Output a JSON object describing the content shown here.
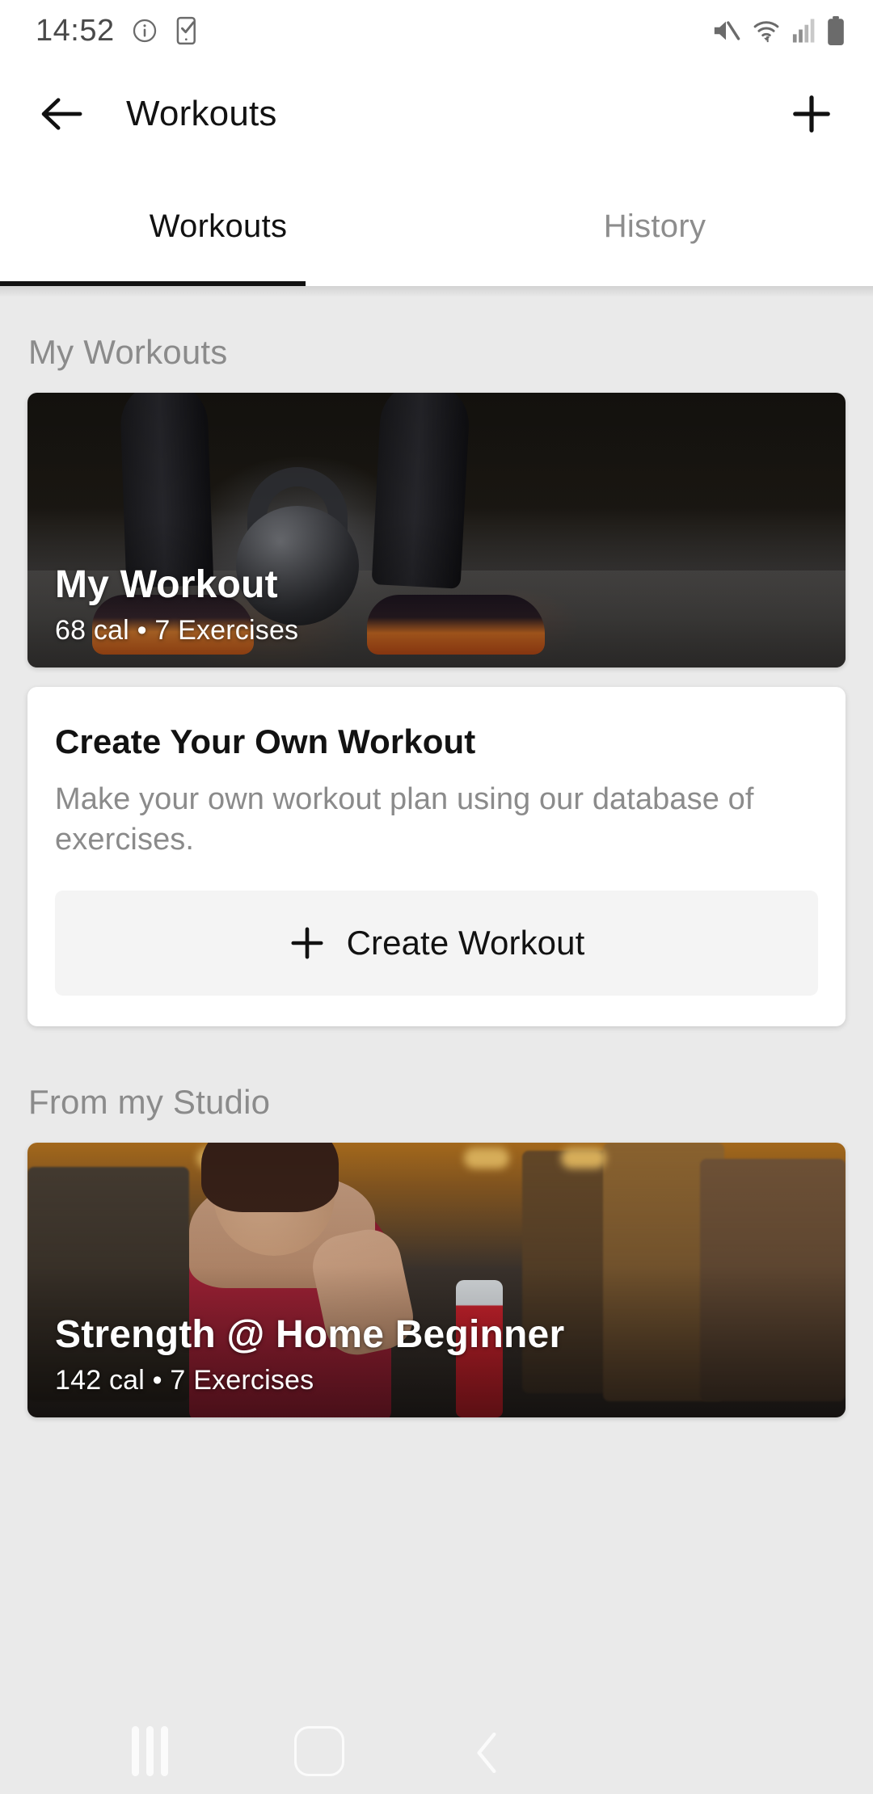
{
  "status_bar": {
    "time": "14:52",
    "icons_left": [
      "info-icon",
      "device-check-icon"
    ],
    "icons_right": [
      "mute-icon",
      "wifi-icon",
      "cellular-signal-icon",
      "battery-icon"
    ]
  },
  "app_bar": {
    "back_icon": "back-arrow-icon",
    "title": "Workouts",
    "add_icon": "plus-icon"
  },
  "tabs": {
    "items": [
      {
        "label": "Workouts",
        "active": true
      },
      {
        "label": "History",
        "active": false
      }
    ]
  },
  "sections": [
    {
      "title": "My Workouts",
      "card": {
        "title": "My Workout",
        "subtitle": "68 cal • 7 Exercises",
        "calories": "68 cal",
        "exercises": "7 Exercises"
      },
      "create_card": {
        "title": "Create Your Own Workout",
        "description": "Make your own workout plan using our database of exercises.",
        "button_label": "Create Workout",
        "button_icon": "plus-icon"
      }
    },
    {
      "title": "From my Studio",
      "card": {
        "title": "Strength @ Home Beginner",
        "subtitle": "142 cal • 7 Exercises",
        "calories": "142 cal",
        "exercises": "7 Exercises"
      }
    }
  ],
  "nav_bar": {
    "recents_icon": "recents-icon",
    "home_icon": "home-icon",
    "back_icon": "back-chevron-icon"
  },
  "colors": {
    "background": "#EAEAEA",
    "surface": "#FFFFFF",
    "accent": "#111111",
    "muted_text": "#8B8B8B",
    "button_fill": "#F4F4F4"
  }
}
